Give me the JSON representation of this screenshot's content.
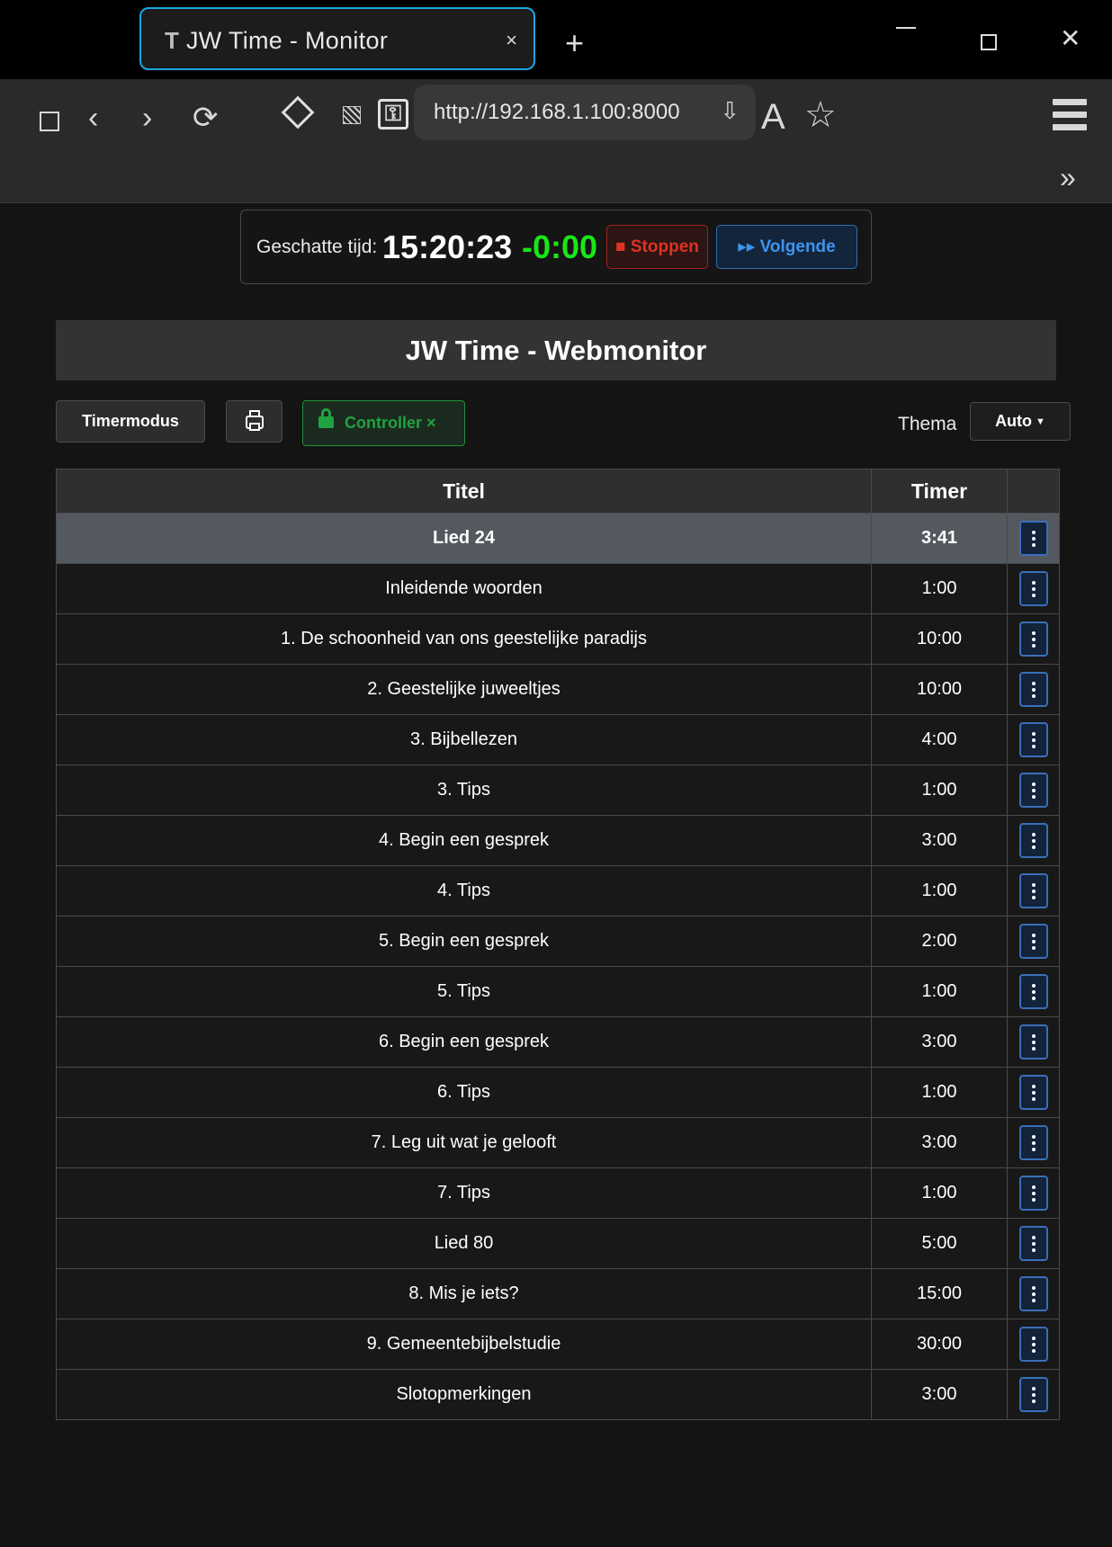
{
  "browser": {
    "tab_favicon": "T",
    "tab_title": "JW Time - Monitor",
    "tab_close": "×",
    "new_tab": "+",
    "window_close": "✕",
    "nav_back": "‹",
    "nav_forward": "›",
    "nav_reload": "⟳",
    "site_info": "⚿",
    "url": "http://192.168.1.100:8000",
    "download_icon": "⇩",
    "reader_icon": "A",
    "bookmark_icon": "☆",
    "overflow": "»"
  },
  "status": {
    "label": "Geschatte tijd:",
    "time": "15:20:23",
    "difference": "-0:00",
    "stop_label": "■ Stoppen",
    "next_label": "▸▸ Volgende"
  },
  "page": {
    "title": "JW Time - Webmonitor"
  },
  "controls": {
    "timermode_label": "Timermodus",
    "controller_label": "Controller ×",
    "theme_label": "Thema",
    "theme_value": "Auto",
    "theme_caret": "▼"
  },
  "table": {
    "headers": {
      "title": "Titel",
      "timer": "Timer"
    },
    "rows": [
      {
        "title": "Lied 24",
        "timer": "3:41",
        "current": true
      },
      {
        "title": "Inleidende woorden",
        "timer": "1:00"
      },
      {
        "title": "1. De schoonheid van ons geestelijke paradijs",
        "timer": "10:00"
      },
      {
        "title": "2. Geestelijke juweeltjes",
        "timer": "10:00"
      },
      {
        "title": "3. Bijbellezen",
        "timer": "4:00"
      },
      {
        "title": "3. Tips",
        "timer": "1:00"
      },
      {
        "title": "4. Begin een gesprek",
        "timer": "3:00"
      },
      {
        "title": "4. Tips",
        "timer": "1:00"
      },
      {
        "title": "5. Begin een gesprek",
        "timer": "2:00"
      },
      {
        "title": "5. Tips",
        "timer": "1:00"
      },
      {
        "title": "6. Begin een gesprek",
        "timer": "3:00"
      },
      {
        "title": "6. Tips",
        "timer": "1:00"
      },
      {
        "title": "7. Leg uit wat je gelooft",
        "timer": "3:00"
      },
      {
        "title": "7. Tips",
        "timer": "1:00"
      },
      {
        "title": "Lied 80",
        "timer": "5:00"
      },
      {
        "title": "8. Mis je iets?",
        "timer": "15:00"
      },
      {
        "title": "9. Gemeentebijbelstudie",
        "timer": "30:00"
      },
      {
        "title": "Slotopmerkingen",
        "timer": "3:00"
      }
    ]
  },
  "colors": {
    "accent_tab": "#1aa7e0",
    "positive": "#19e619",
    "stop": "#e03225",
    "next": "#3d95ef",
    "controller": "#21a242",
    "current_row": "#54585f"
  }
}
